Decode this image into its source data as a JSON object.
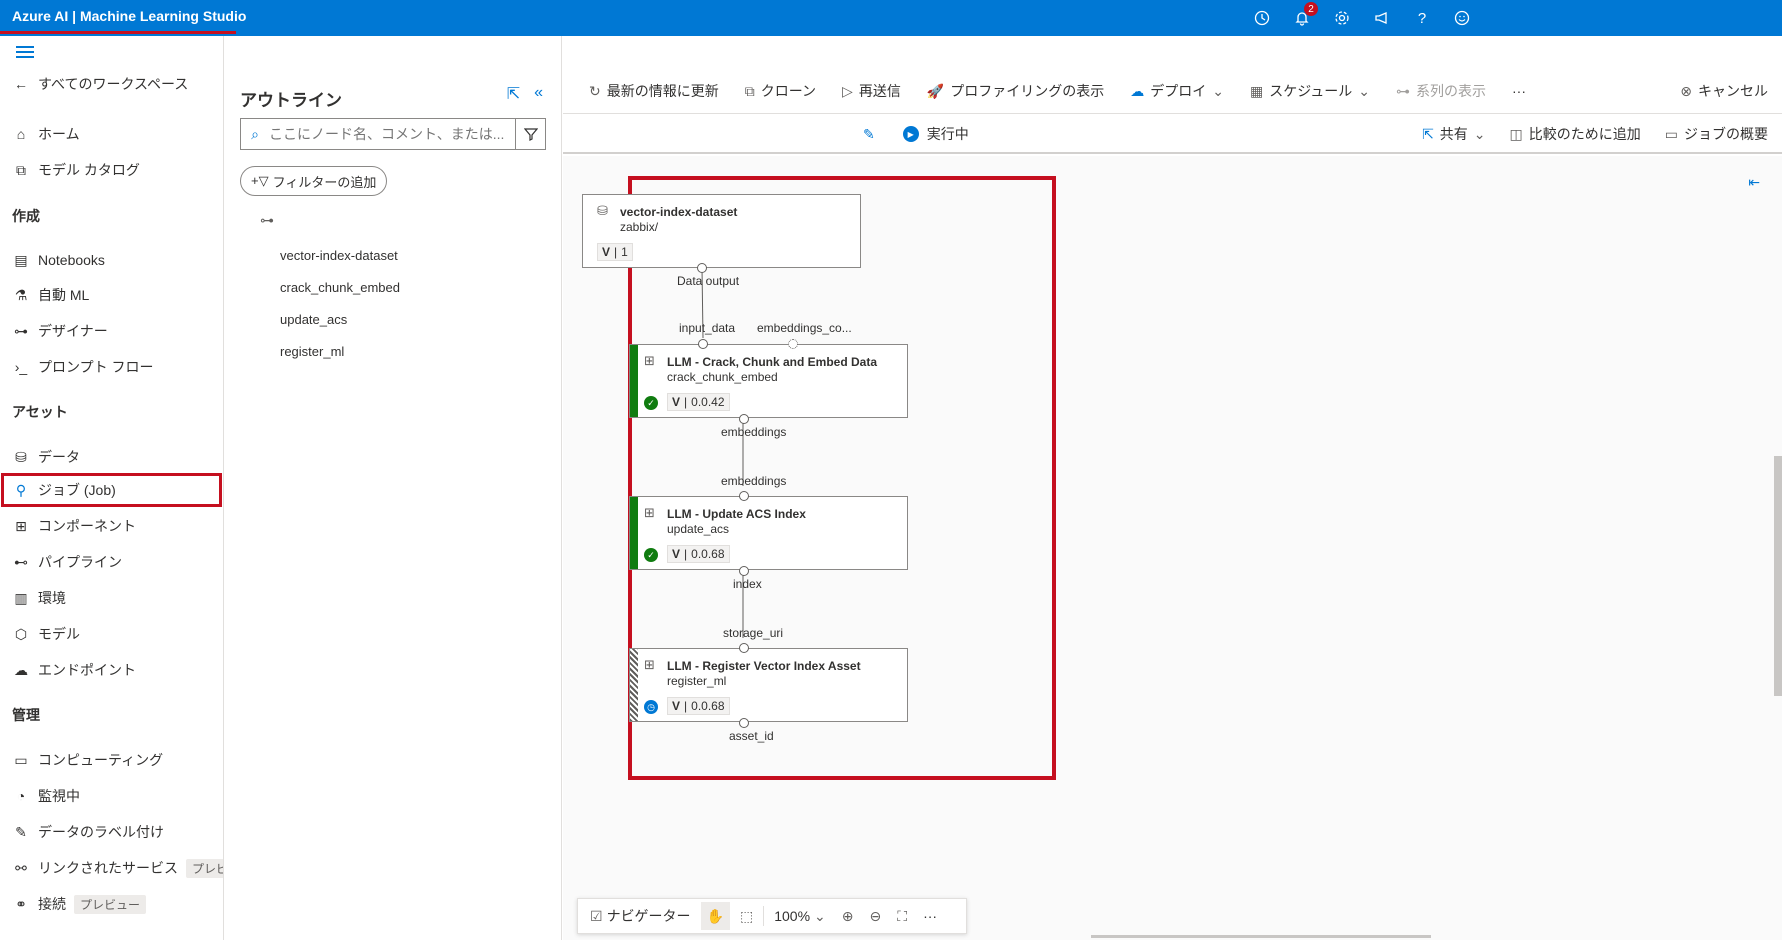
{
  "app": {
    "title": "Azure AI | Machine Learning Studio",
    "notification_count": "2"
  },
  "leftnav": {
    "back_label": "すべてのワークスペース",
    "home": "ホーム",
    "model_catalog": "モデル カタログ",
    "section_create": "作成",
    "notebooks": "Notebooks",
    "automl": "自動 ML",
    "designer": "デザイナー",
    "promptflow": "プロンプト フロー",
    "section_assets": "アセット",
    "data": "データ",
    "jobs": "ジョブ (Job)",
    "components": "コンポーネント",
    "pipelines": "パイプライン",
    "environments": "環境",
    "models": "モデル",
    "endpoints": "エンドポイント",
    "section_manage": "管理",
    "compute": "コンピューティング",
    "monitoring": "監視中",
    "labeling": "データのラベル付け",
    "linked_services": "リンクされたサービス",
    "linked_services_badge": "プレビ",
    "connections": "接続",
    "connections_badge": "プレビュー"
  },
  "outline": {
    "title": "アウトライン",
    "search_placeholder": "ここにノード名、コメント、または...",
    "add_filter": "フィルターの追加",
    "nodes": [
      "vector-index-dataset",
      "crack_chunk_embed",
      "update_acs",
      "register_ml"
    ]
  },
  "toolbar": {
    "refresh": "最新の情報に更新",
    "clone": "クローン",
    "resubmit": "再送信",
    "profiling": "プロファイリングの表示",
    "deploy": "デプロイ",
    "schedule": "スケジュール",
    "lineage": "系列の表示",
    "more": "···",
    "cancel": "キャンセル"
  },
  "subbar": {
    "status": "実行中",
    "share": "共有",
    "compare": "比較のために追加",
    "job_overview": "ジョブの概要"
  },
  "graph": {
    "dataset": {
      "title": "vector-index-dataset",
      "sub": "zabbix/",
      "version_label": "V",
      "version": "1",
      "out_port": "Data output"
    },
    "node1": {
      "title": "LLM - Crack, Chunk and Embed Data",
      "sub": "crack_chunk_embed",
      "version_label": "V",
      "version": "0.0.42",
      "in_port1": "input_data",
      "in_port2": "embeddings_co...",
      "out_port": "embeddings"
    },
    "node2": {
      "title": "LLM - Update ACS Index",
      "sub": "update_acs",
      "version_label": "V",
      "version": "0.0.68",
      "in_port": "embeddings",
      "out_port": "index"
    },
    "node3": {
      "title": "LLM - Register Vector Index Asset",
      "sub": "register_ml",
      "version_label": "V",
      "version": "0.0.68",
      "in_port": "storage_uri",
      "out_port": "asset_id"
    }
  },
  "navigator": {
    "label": "ナビゲーター",
    "zoom": "100%",
    "more": "···"
  },
  "colors": {
    "accent": "#0078d4",
    "highlight": "#c50f1f",
    "success": "#107c10"
  }
}
